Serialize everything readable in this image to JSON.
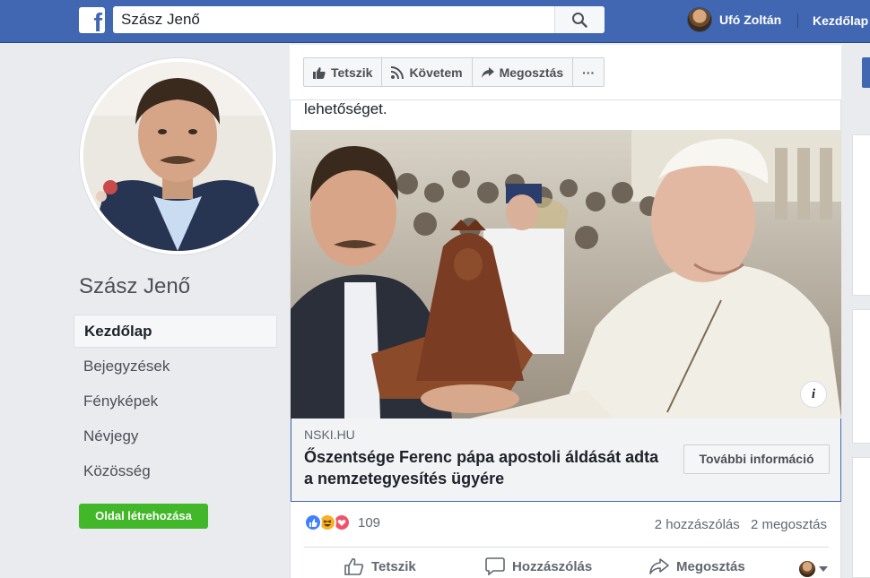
{
  "topbar": {
    "logo_letter": "f",
    "search_value": "Szász Jenő",
    "user_name": "Ufó Zoltán",
    "home_label": "Kezdőlap"
  },
  "sidebar": {
    "page_name": "Szász Jenő",
    "items": [
      {
        "label": "Kezdőlap"
      },
      {
        "label": "Bejegyzések"
      },
      {
        "label": "Fényképek"
      },
      {
        "label": "Névjegy"
      },
      {
        "label": "Közösség"
      }
    ],
    "create_page_label": "Oldal létrehozása"
  },
  "page_actions": {
    "like_label": "Tetszik",
    "follow_label": "Követem",
    "share_label": "Megosztás",
    "more_label": "···"
  },
  "post": {
    "cut_text": "lehetőséget.",
    "info_label": "i",
    "link_domain": "NSKI.HU",
    "link_title": "Őszentsége Ferenc pápa apostoli áldását adta a nemzetegyesítés ügyére",
    "more_info_label": "További információ",
    "reaction_count": "109",
    "comments_text": "2 hozzászólás",
    "shares_text": "2 megosztás",
    "actions": {
      "like": "Tetszik",
      "comment": "Hozzászólás",
      "share": "Megosztás"
    }
  },
  "colors": {
    "brand_blue": "#4267b2",
    "create_green": "#42b72a",
    "like_blue": "#4080ff",
    "haha_yellow": "#f7b125",
    "love_red": "#f25268"
  }
}
